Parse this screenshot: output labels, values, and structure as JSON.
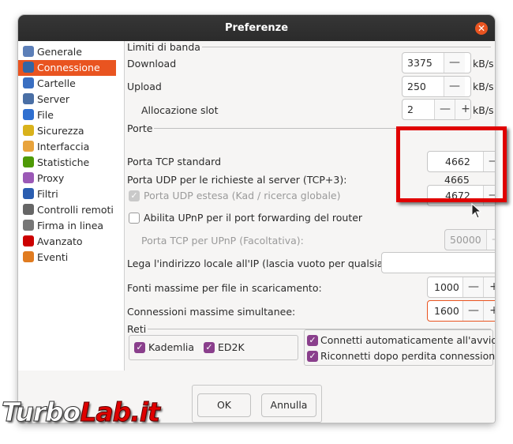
{
  "window": {
    "title": "Preferenze"
  },
  "sidebar": {
    "items": [
      {
        "label": "Generale",
        "icon": "general-icon",
        "color": "#5c7fb8"
      },
      {
        "label": "Connessione",
        "icon": "connection-icon",
        "color": "#3465a4"
      },
      {
        "label": "Cartelle",
        "icon": "folder-icon",
        "color": "#3a6fc2"
      },
      {
        "label": "Server",
        "icon": "server-icon",
        "color": "#4a6fa5"
      },
      {
        "label": "File",
        "icon": "file-icon",
        "color": "#2f6fd0"
      },
      {
        "label": "Sicurezza",
        "icon": "lock-icon",
        "color": "#d9b21c"
      },
      {
        "label": "Interfaccia",
        "icon": "interface-icon",
        "color": "#e8a33c"
      },
      {
        "label": "Statistiche",
        "icon": "statistics-icon",
        "color": "#4e9a06"
      },
      {
        "label": "Proxy",
        "icon": "proxy-icon",
        "color": "#9b59b6"
      },
      {
        "label": "Filtri",
        "icon": "filter-icon",
        "color": "#2a5db0"
      },
      {
        "label": "Controlli remoti",
        "icon": "remote-control-icon",
        "color": "#666666"
      },
      {
        "label": "Firma in linea",
        "icon": "online-signature-icon",
        "color": "#777777"
      },
      {
        "label": "Avanzato",
        "icon": "advanced-icon",
        "color": "#cc0000"
      },
      {
        "label": "Eventi",
        "icon": "events-icon",
        "color": "#e07b20"
      }
    ],
    "selected": "Connessione",
    "accent": "#e95420"
  },
  "bandwidth": {
    "group_label": "Limiti di banda",
    "download_label": "Download",
    "download_value": "3375",
    "upload_label": "Upload",
    "upload_value": "250",
    "slot_label": "Allocazione slot",
    "slot_value": "2",
    "unit": "kB/s"
  },
  "ports": {
    "group_label": "Porte",
    "tcp_label": "Porta TCP standard",
    "tcp_value": "4662",
    "udp_label": "Porta UDP per le richieste al server (TCP+3):",
    "udp_value": "4665",
    "udp_ext_label": "Porta UDP estesa (Kad / ricerca globale)",
    "udp_ext_value": "4672",
    "upnp_label": "Abilita UPnP per il port forwarding del router",
    "upnp_tcp_label": "Porta TCP per UPnP (Facoltativa):",
    "upnp_tcp_value": "50000"
  },
  "bind_ip_label": "Lega l'indirizzo locale all'IP (lascia vuoto per qualsiasi):",
  "bind_ip_value": "",
  "max_sources_label": "Fonti massime per file in scaricamento:",
  "max_sources_value": "1000",
  "max_connections_label": "Connessioni massime simultanee:",
  "max_connections_value": "1600",
  "networks": {
    "group_label": "Reti",
    "kademlia": "Kademlia",
    "ed2k": "ED2K",
    "autoconnect": "Connetti automaticamente all'avvio",
    "reconnect": "Riconnetti dopo perdita connessione"
  },
  "buttons": {
    "ok": "OK",
    "cancel": "Annulla"
  },
  "spin": {
    "minus": "—",
    "plus": "+"
  },
  "watermark": {
    "part1": "Turbo",
    "part2": "Lab.it"
  }
}
